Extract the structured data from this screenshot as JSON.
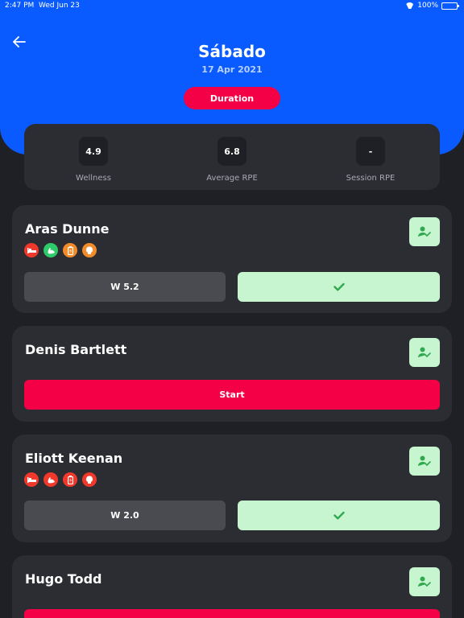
{
  "status_bar": {
    "time": "2:47 PM",
    "date": "Wed Jun 23",
    "battery": "100%"
  },
  "header": {
    "title": "Sábado",
    "date": "17 Apr 2021",
    "duration_label": "Duration"
  },
  "summary": {
    "wellness_value": "4.9",
    "wellness_label": "Wellness",
    "avg_rpe_value": "6.8",
    "avg_rpe_label": "Average RPE",
    "session_rpe_value": "-",
    "session_rpe_label": "Session RPE"
  },
  "players": [
    {
      "name": "Aras Dunne",
      "wellness": "W 5.2",
      "badges": [
        "bed-icon",
        "muscle-icon",
        "battery-icon",
        "brain-icon"
      ]
    },
    {
      "name": "Denis Bartlett",
      "start_label": "Start"
    },
    {
      "name": "Eliott Keenan",
      "wellness": "W 2.0",
      "badges": [
        "bed-icon",
        "muscle-icon",
        "battery-icon",
        "brain-icon"
      ]
    },
    {
      "name": "Hugo Todd"
    }
  ],
  "colors": {
    "primary_blue": "#0a5bff",
    "accent_red": "#f40047",
    "success_green": "#c7f5cf",
    "check_green": "#2fa84f",
    "card": "#2c2d33",
    "background": "#1f2025"
  }
}
